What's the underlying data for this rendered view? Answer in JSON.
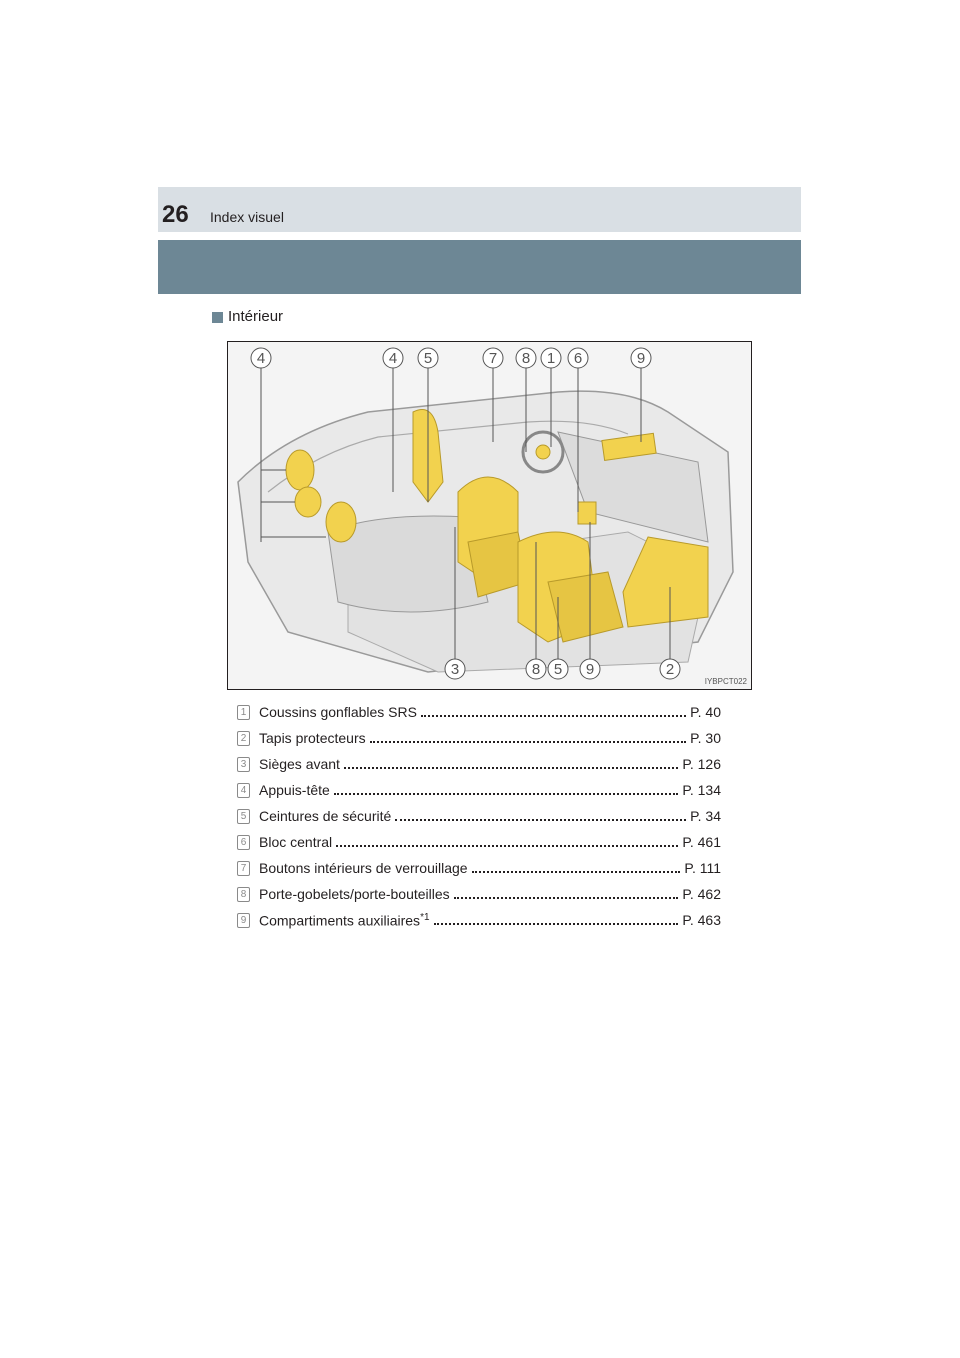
{
  "header": {
    "page_number": "26",
    "title": "Index visuel"
  },
  "section": {
    "title": "Intérieur"
  },
  "figure": {
    "code": "IYBPCT022",
    "highlight_color": "#f2d24e",
    "callouts_top": [
      "4",
      "4",
      "5",
      "7",
      "8",
      "1",
      "6",
      "9"
    ],
    "callouts_bottom": [
      "3",
      "8",
      "5",
      "9",
      "2"
    ]
  },
  "items": [
    {
      "num": "1",
      "label": "Coussins gonflables SRS",
      "sup": "",
      "page": "P. 40"
    },
    {
      "num": "2",
      "label": "Tapis protecteurs",
      "sup": "",
      "page": "P. 30"
    },
    {
      "num": "3",
      "label": "Sièges avant",
      "sup": "",
      "page": "P. 126"
    },
    {
      "num": "4",
      "label": "Appuis-tête",
      "sup": "",
      "page": "P. 134"
    },
    {
      "num": "5",
      "label": "Ceintures de sécurité",
      "sup": "",
      "page": "P. 34"
    },
    {
      "num": "6",
      "label": "Bloc central",
      "sup": "",
      "page": "P. 461"
    },
    {
      "num": "7",
      "label": "Boutons intérieurs de verrouillage",
      "sup": "",
      "page": "P. 111"
    },
    {
      "num": "8",
      "label": "Porte-gobelets/porte-bouteilles",
      "sup": "",
      "page": "P. 462"
    },
    {
      "num": "9",
      "label": "Compartiments auxiliaires",
      "sup": "*1",
      "page": "P. 463"
    }
  ]
}
